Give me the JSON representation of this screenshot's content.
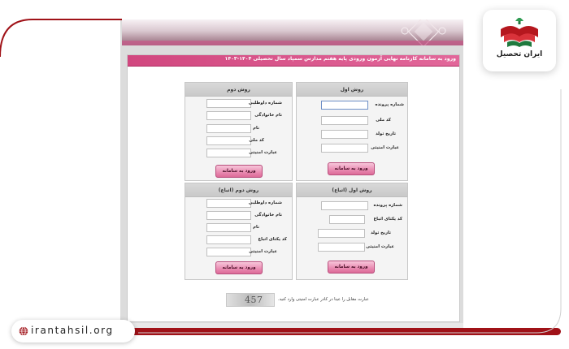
{
  "header": {
    "title": "ورود به سامانه کارنامه نهایی آزمون ورودی پایه هفتم مدارس سمپاد سال تحصیلی ۱۴۰۴-۱۴۰۳"
  },
  "panel_method1": {
    "heading": "روش اول",
    "fields": [
      {
        "label": "شماره پرونده",
        "value": ""
      },
      {
        "label": "کد ملی",
        "value": ""
      },
      {
        "label": "تاریخ تولد",
        "value": ""
      },
      {
        "label": "عبارت امنیتی",
        "value": ""
      }
    ],
    "submit": "ورود به سامانه"
  },
  "panel_method2": {
    "heading": "روش دوم",
    "fields": [
      {
        "label": "شماره داوطلبی",
        "value": ""
      },
      {
        "label": "نام خانوادگی",
        "value": ""
      },
      {
        "label": "نام",
        "value": ""
      },
      {
        "label": "کد ملی",
        "value": ""
      },
      {
        "label": "عبارت امنیتی",
        "value": ""
      }
    ],
    "submit": "ورود به سامانه"
  },
  "panel_method1_foreign": {
    "heading": "روش اول (اتباع)",
    "fields": [
      {
        "label": "شماره پرونده",
        "value": ""
      },
      {
        "label": "کد یکتای اتباع",
        "value": ""
      },
      {
        "label": "تاریخ تولد",
        "value": ""
      },
      {
        "label": "عبارت امنیتی",
        "value": ""
      }
    ],
    "submit": "ورود به سامانه"
  },
  "panel_method2_foreign": {
    "heading": "روش دوم (اتباع)",
    "fields": [
      {
        "label": "شماره داوطلبی",
        "value": ""
      },
      {
        "label": "نام خانوادگی",
        "value": ""
      },
      {
        "label": "نام",
        "value": ""
      },
      {
        "label": "کد یکتای اتباع",
        "value": ""
      },
      {
        "label": "عبارت امنیتی",
        "value": ""
      }
    ],
    "submit": "ورود به سامانه"
  },
  "captcha": {
    "code": "457",
    "note": "عبارت مقابل را عینا در کادر عبارت امنیتی وارد کنید."
  },
  "brand": {
    "logo_caption": "ایران تحصیل",
    "website": "irantahsil.org",
    "globe_icon": "globe-icon",
    "accent": "#a01218",
    "pink": "#d1477f"
  }
}
